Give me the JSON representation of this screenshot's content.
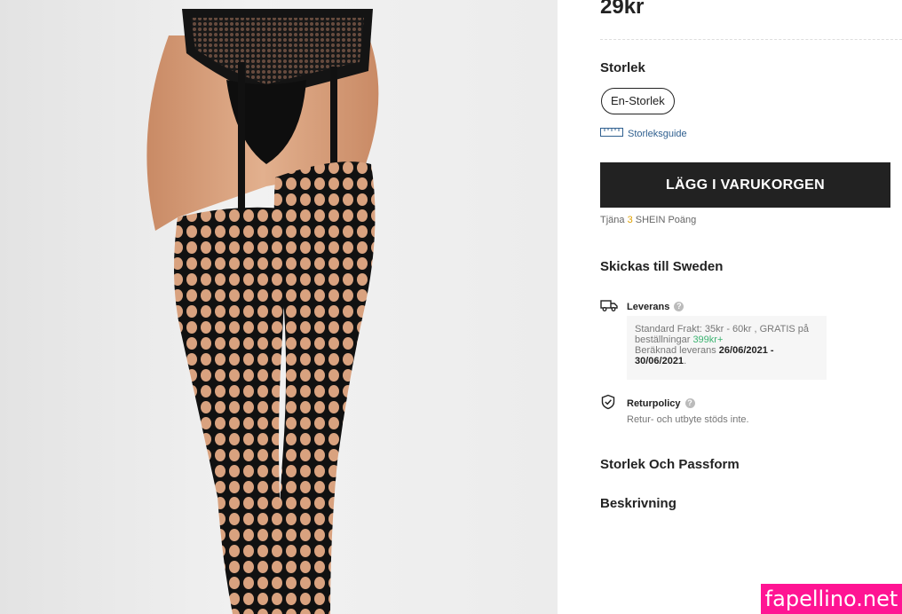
{
  "product": {
    "price": "29kr",
    "image_alt": "Product photo: black fishnet garter stockings"
  },
  "size": {
    "title": "Storlek",
    "options": [
      "En-Storlek"
    ],
    "guide_label": "Storleksguide"
  },
  "cart": {
    "button_label": "LÄGG I VARUKORGEN"
  },
  "points": {
    "prefix": "Tjäna",
    "amount": "3",
    "suffix": "SHEIN Poäng"
  },
  "shipping": {
    "title": "Skickas till Sweden",
    "delivery": {
      "label": "Leverans",
      "standard_text": "Standard Frakt: 35kr - 60kr , GRATIS på beställningar",
      "free_threshold": "399kr+",
      "estimate_prefix": "Beräknad leverans",
      "estimate_range_start": "26/06/2021 -",
      "estimate_range_end": "30/06/2021",
      "estimate_suffix": "."
    },
    "return_policy": {
      "label": "Returpolicy",
      "note": "Retur- och utbyte stöds inte."
    }
  },
  "sections": {
    "size_fit": "Storlek Och Passform",
    "description": "Beskrivning"
  },
  "watermark": "fapellino.net",
  "colors": {
    "button_bg": "#222222",
    "accent_yellow": "#e0a100",
    "accent_green": "#3cb371",
    "link_blue": "#2f5f8f",
    "watermark_bg": "#ff1493"
  }
}
